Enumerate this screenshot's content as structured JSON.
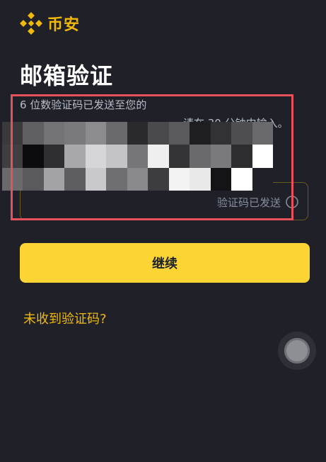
{
  "brand": {
    "name": "币安",
    "color": "#f0b90b"
  },
  "page": {
    "title": "邮箱验证",
    "hint_line1": "6 位数验证码已发送至您的",
    "hint_line2_tail": "请在 30 分钟内输入。"
  },
  "code_field": {
    "status_text": "验证码已发送",
    "status_icon": "spinner-icon"
  },
  "actions": {
    "continue_label": "继续",
    "resend_link": "未收到验证码?"
  },
  "colors": {
    "background": "#1f2028",
    "accent": "#fcd535",
    "annotation_box": "#e8505b"
  }
}
